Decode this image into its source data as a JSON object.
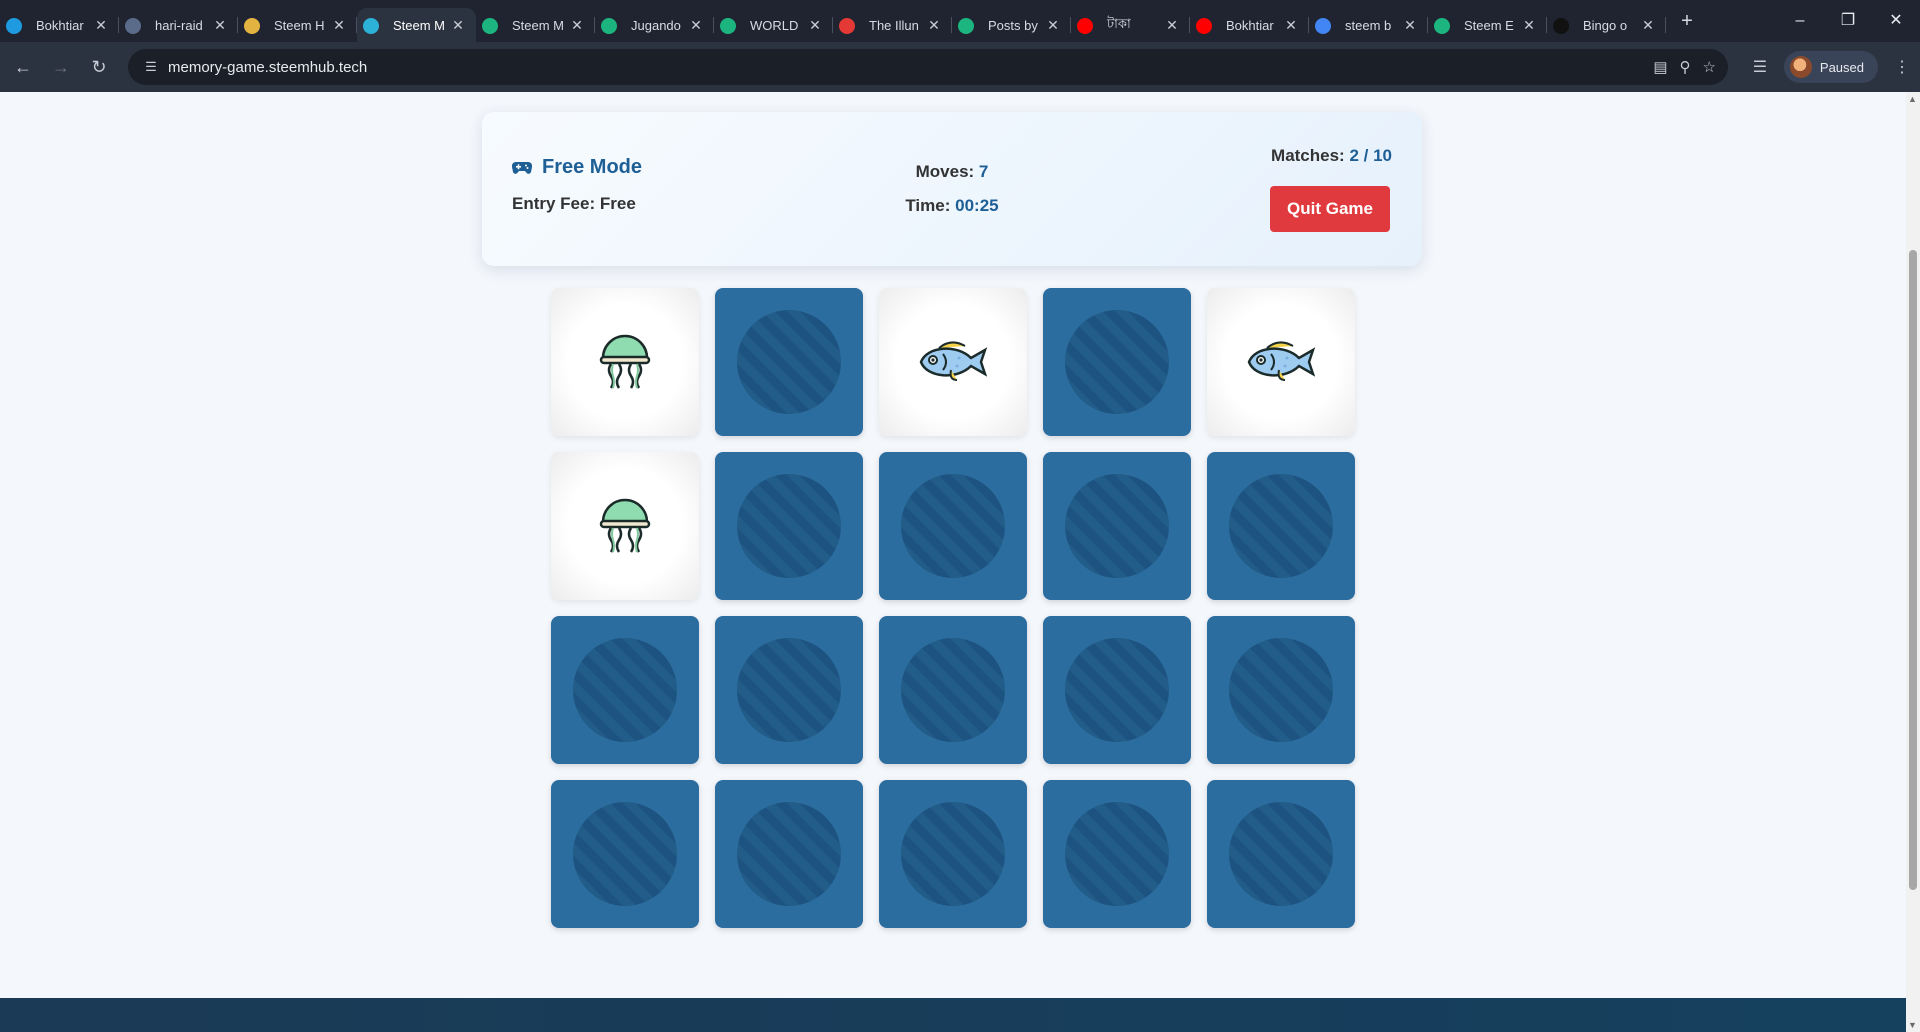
{
  "browser": {
    "tabs": [
      {
        "title": "Bokhtiar",
        "favicon_color": "#1e9be0",
        "active": false
      },
      {
        "title": "hari-raid",
        "favicon_color": "#5a6c8a",
        "active": false
      },
      {
        "title": "Steem H",
        "favicon_color": "#e3b341",
        "active": false
      },
      {
        "title": "Steem M",
        "favicon_color": "#2cb2d8",
        "active": true
      },
      {
        "title": "Steem M",
        "favicon_color": "#1db57f",
        "active": false
      },
      {
        "title": "Jugando",
        "favicon_color": "#1db57f",
        "active": false
      },
      {
        "title": "WORLD",
        "favicon_color": "#1db57f",
        "active": false
      },
      {
        "title": "The Illun",
        "favicon_color": "#e53935",
        "active": false
      },
      {
        "title": "Posts by",
        "favicon_color": "#1db57f",
        "active": false
      },
      {
        "title": "টাকা",
        "favicon_color": "#ff0000",
        "active": false
      },
      {
        "title": "Bokhtiar",
        "favicon_color": "#ff0000",
        "active": false
      },
      {
        "title": "steem b",
        "favicon_color": "#4285f4",
        "active": false
      },
      {
        "title": "Steem E",
        "favicon_color": "#1db57f",
        "active": false
      },
      {
        "title": "Bingo o",
        "favicon_color": "#111111",
        "active": false
      }
    ],
    "url": "memory-game.steemhub.tech",
    "profile_label": "Paused"
  },
  "game": {
    "mode": "Free Mode",
    "entry_fee_label": "Entry Fee:",
    "entry_fee_value": "Free",
    "moves_label": "Moves:",
    "moves_value": "7",
    "time_label": "Time:",
    "time_value": "00:25",
    "matches_label": "Matches:",
    "matches_value": "2 / 10",
    "quit_label": "Quit Game"
  },
  "board": {
    "cards": [
      {
        "state": "up",
        "icon": "jellyfish-icon"
      },
      {
        "state": "down"
      },
      {
        "state": "up",
        "icon": "fish-icon"
      },
      {
        "state": "down"
      },
      {
        "state": "up",
        "icon": "fish-icon"
      },
      {
        "state": "up",
        "icon": "jellyfish-icon"
      },
      {
        "state": "down"
      },
      {
        "state": "down"
      },
      {
        "state": "down"
      },
      {
        "state": "down"
      },
      {
        "state": "down"
      },
      {
        "state": "down"
      },
      {
        "state": "down"
      },
      {
        "state": "down"
      },
      {
        "state": "down"
      },
      {
        "state": "down"
      },
      {
        "state": "down"
      },
      {
        "state": "down"
      },
      {
        "state": "down"
      },
      {
        "state": "down"
      }
    ]
  },
  "colors": {
    "accent": "#1e5f96",
    "card_back": "#2b6d9f",
    "quit_button": "#e03a3f"
  }
}
